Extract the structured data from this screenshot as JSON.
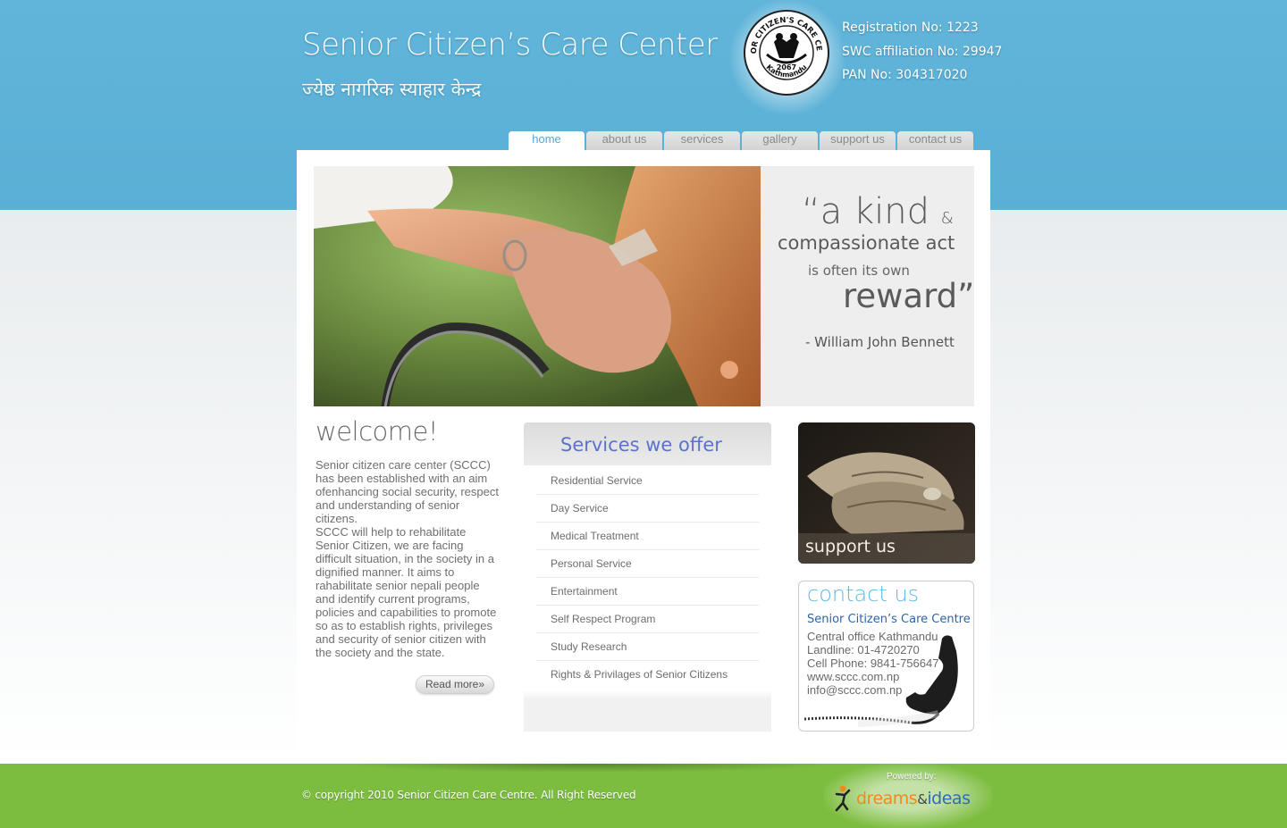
{
  "header": {
    "title": "Senior Citizen’s Care Center",
    "title_nepali": "ज्येष्ठ नागरिक स्याहार केन्द्र",
    "logo_alt": "logo-seal",
    "logo_ring_top": "SENIOR CITIZEN'S CARE CENTER",
    "logo_year": "2067",
    "logo_ring_bottom": "Kathmandu",
    "registration": "Registration No: 1223",
    "swc_affiliation": "SWC affiliation No: 29947",
    "pan": "PAN No: 304317020"
  },
  "nav": {
    "active": "home",
    "items": [
      "home",
      "about us",
      "services",
      "gallery",
      "support us",
      "contact us"
    ]
  },
  "hero": {
    "quote_line1": "“a kind",
    "quote_amp": "&",
    "quote_line2": "compassionate act",
    "quote_line3": "is often its own",
    "quote_line4": "reward”",
    "author": "- William John Bennett"
  },
  "welcome": {
    "title": "welcome!",
    "para1": "Senior citizen care center (SCCC) has been established with an aim ofenhancing social security, respect and understanding of senior citizens.",
    "para2": "SCCC will help to rehabilitate Senior Citizen, we are facing difficult situation, in the society in a dignified manner. It aims to rahabilitate senior nepali people and identify current programs, policies and capabilities to promote so as to establish rights, privileges and security of senior citizen with the society and the state.",
    "read_more": "Read more»"
  },
  "services": {
    "title": "Services we offer",
    "items": [
      "Residential Service",
      "Day Service",
      "Medical Treatment",
      "Personal Service",
      "Entertainment",
      "Self Respect Program",
      "Study Research",
      "Rights & Privilages of Senior Citizens"
    ]
  },
  "support": {
    "label": "support us"
  },
  "contact": {
    "title": "contact us",
    "org": "Senior Citizen’s Care Centre",
    "office": "Central office Kathmandu",
    "landline": "Landline: 01-4720270",
    "cell": "Cell Phone: 9841-756647",
    "website": "www.sccc.com.np",
    "email": "info@sccc.com.np"
  },
  "footer": {
    "copyright": "© copyright 2010 Senior Citizen Care Centre. All Right Reserved",
    "powered_by": "Powered by:",
    "brand_part1": "dreams",
    "brand_amp": "&",
    "brand_part2": "ideas"
  },
  "colors": {
    "header_blue": "#5aafd6",
    "footer_green": "#7cbd3f",
    "services_title": "#5b73c9",
    "contact_title": "#62b9e2"
  }
}
